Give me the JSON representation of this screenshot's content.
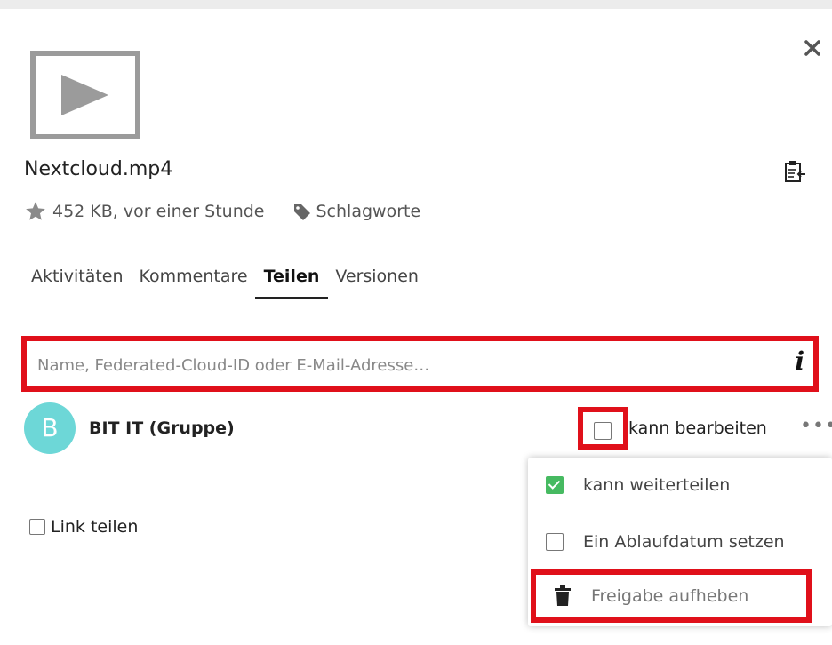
{
  "file": {
    "name": "Nextcloud.mp4",
    "size_time": "452 KB, vor einer Stunde",
    "tags_label": "Schlagworte"
  },
  "tabs": [
    {
      "label": "Aktivitäten"
    },
    {
      "label": "Kommentare"
    },
    {
      "label": "Teilen"
    },
    {
      "label": "Versionen"
    }
  ],
  "search": {
    "placeholder": "Name, Federated-Cloud-ID oder E-Mail-Adresse…",
    "info_glyph": "i"
  },
  "share": {
    "avatar_letter": "B",
    "name": "BIT IT (Gruppe)",
    "edit_label": "kann bearbeiten",
    "edit_checked": false,
    "more_glyph": "•••"
  },
  "link_share": {
    "label": "Link teilen",
    "checked": false
  },
  "dropdown": {
    "items": [
      {
        "label": "kann weiterteilen",
        "checked": true
      },
      {
        "label": "Ein Ablaufdatum setzen",
        "checked": false
      },
      {
        "label": "Freigabe aufheben"
      }
    ]
  },
  "colors": {
    "highlight": "#e0101a",
    "avatar": "#6dd7d7",
    "check": "#46ba61"
  }
}
